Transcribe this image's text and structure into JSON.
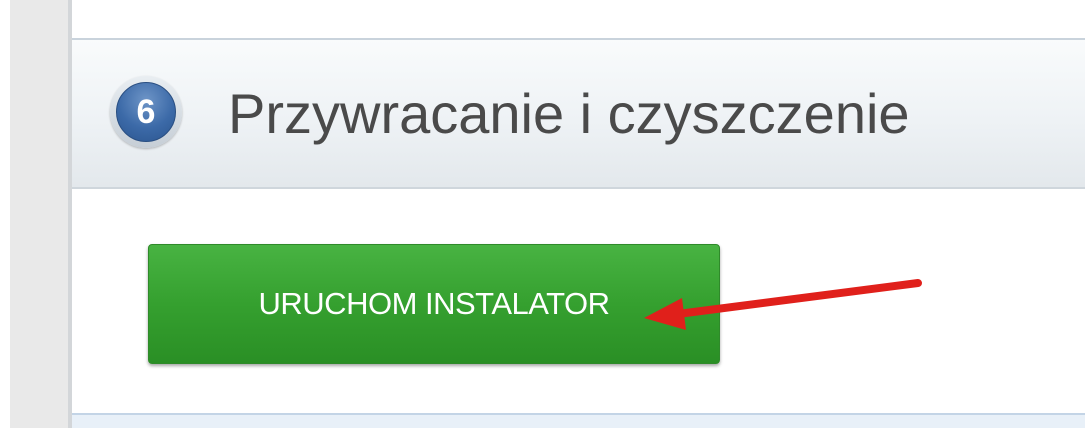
{
  "section": {
    "step_number": "6",
    "title": "Przywracanie i czyszczenie"
  },
  "installer_button": {
    "label": "URUCHOM INSTALATOR"
  },
  "annotation": {
    "arrow_color": "#e0201b"
  },
  "colors": {
    "button_green": "#35a02f",
    "badge_blue": "#3c6aa8",
    "title_gray": "#4a4a4a"
  }
}
